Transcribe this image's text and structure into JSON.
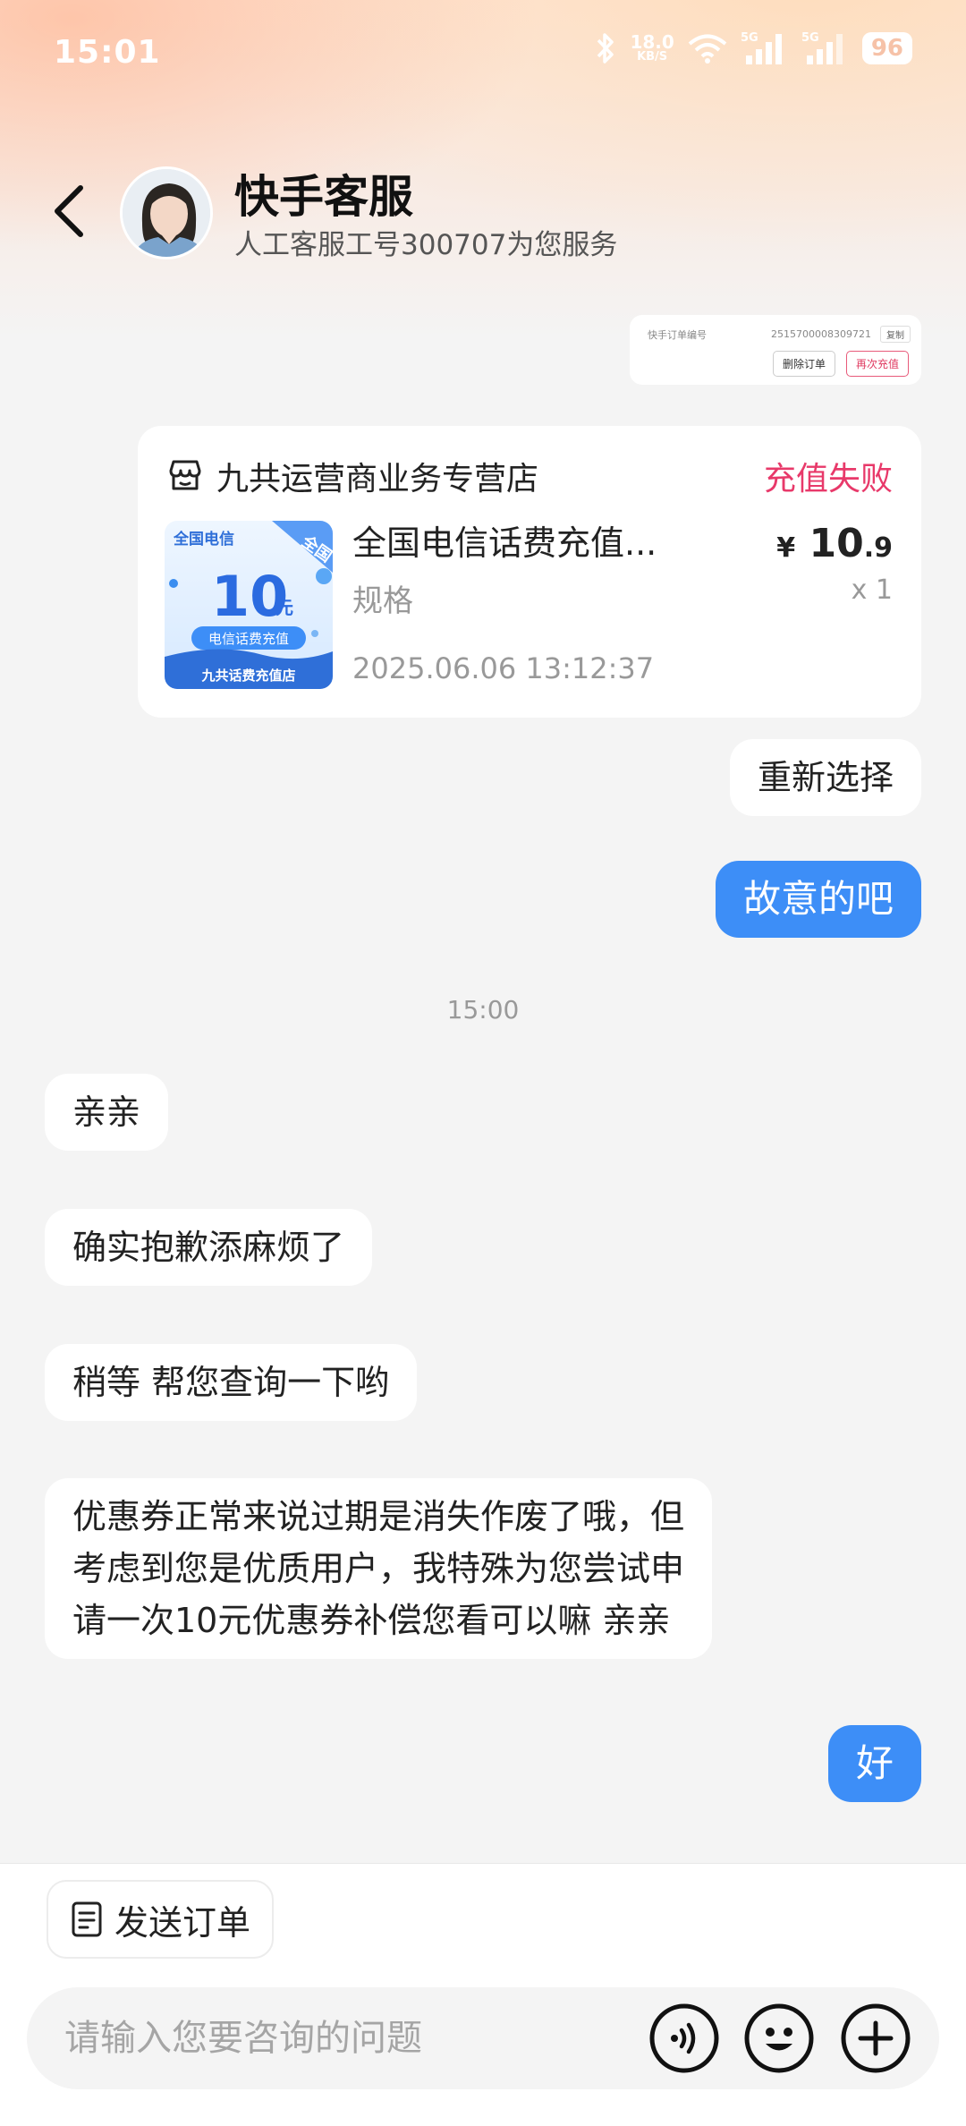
{
  "status_bar": {
    "time": "15:01",
    "speed_value": "18.0",
    "speed_unit": "KB/S",
    "battery": "96"
  },
  "header": {
    "title": "快手客服",
    "subtitle": "人工客服工号300707为您服务"
  },
  "order_preview": {
    "label": "快手订单编号",
    "order_number": "2515700008309721",
    "copy_label": "复制",
    "delete_label": "删除订单",
    "recharge_label": "再次充值"
  },
  "order_card": {
    "store_name": "九共运营商业务专营店",
    "status": "充值失败",
    "product_name": "全国电信话费充值...",
    "spec": "规格",
    "time": "2025.06.06 13:12:37",
    "price_symbol": "¥",
    "price_int": "10",
    "price_dec": ".9",
    "quantity": "x 1",
    "thumb": {
      "top_left": "全国电信",
      "corner": "全国",
      "amount": "10",
      "unit": "元",
      "pill": "电信话费充值",
      "footer": "九共话费充值店"
    }
  },
  "messages": [
    {
      "from": "user",
      "text": "重新选择"
    },
    {
      "from": "user",
      "text": "故意的吧"
    },
    {
      "from": "system",
      "text": "15:00"
    },
    {
      "from": "agent",
      "text": "亲亲"
    },
    {
      "from": "agent",
      "text": "确实抱歉添麻烦了"
    },
    {
      "from": "agent",
      "text": "稍等 帮您查询一下哟"
    },
    {
      "from": "agent",
      "lines": [
        "优惠券正常来说过期是消失作废了哦，但",
        "考虑到您是优质用户，我特殊为您尝试申",
        "请一次10元优惠券补偿您看可以嘛 亲亲"
      ]
    },
    {
      "from": "user",
      "text": "好"
    }
  ],
  "bottom": {
    "send_order_label": "发送订单",
    "input_placeholder": "请输入您要咨询的问题"
  },
  "colors": {
    "accent_blue": "#3d8ef7",
    "status_red": "#e8396a"
  }
}
